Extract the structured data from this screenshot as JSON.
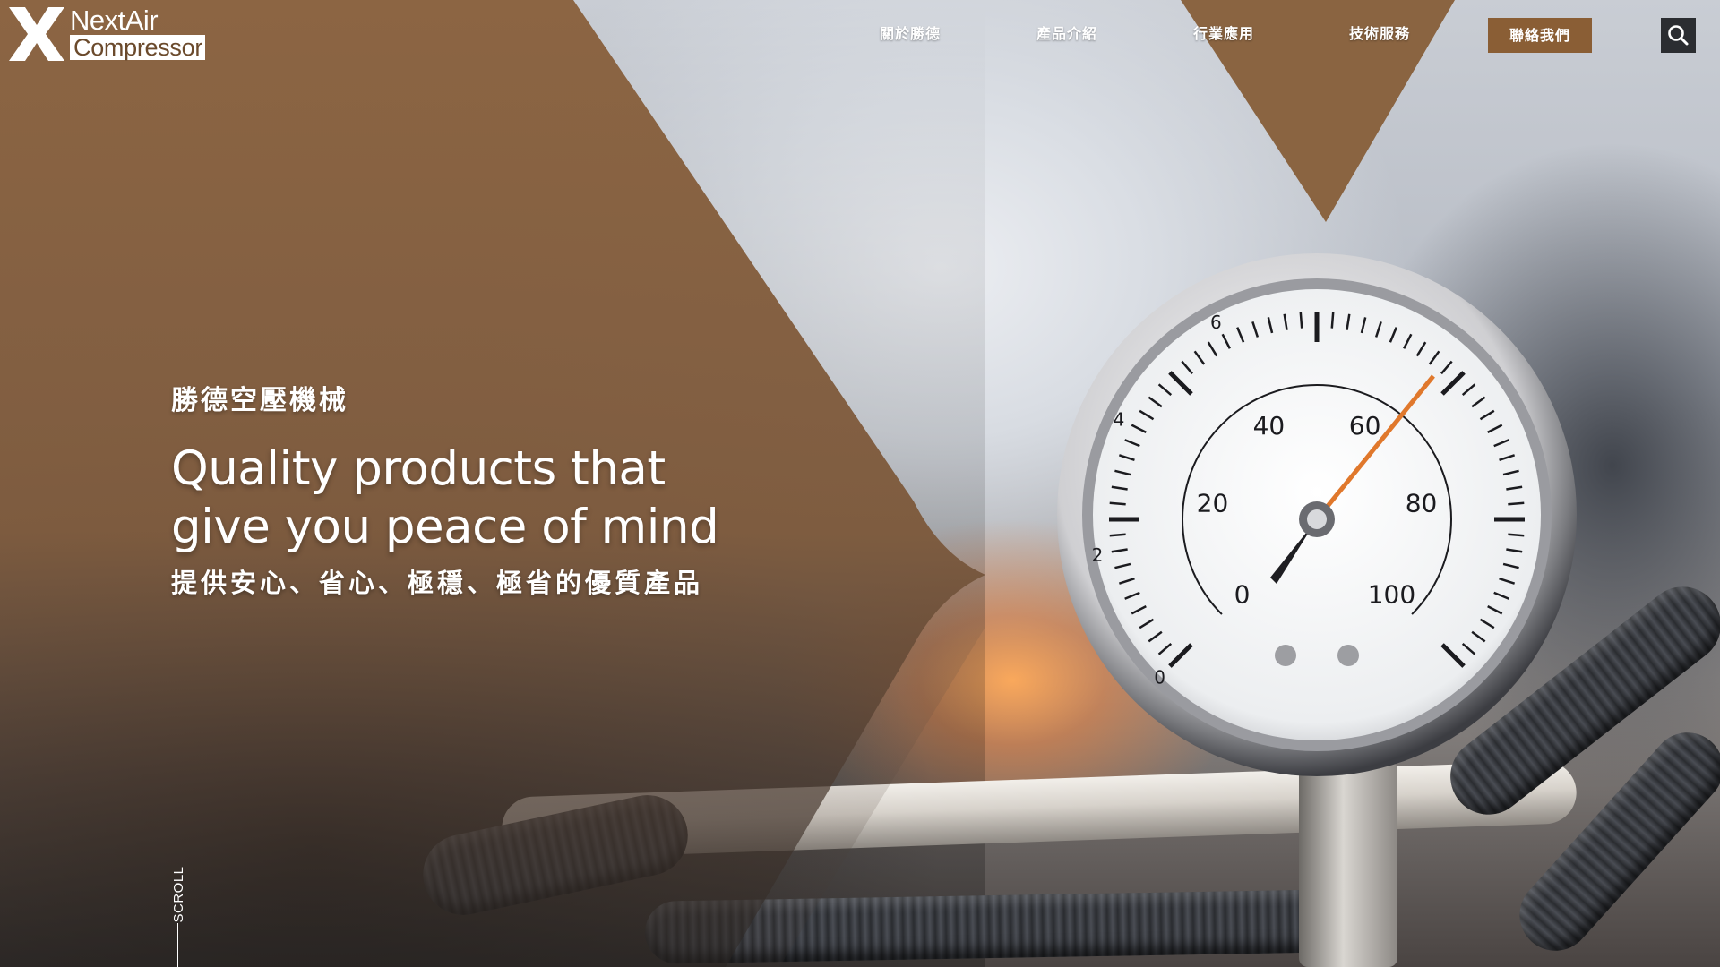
{
  "brand": {
    "name": "NextAir",
    "sub": "Compressor",
    "color_primary": "#8a5e35",
    "color_panel": "#8a6441"
  },
  "nav": {
    "items": [
      {
        "label": "關於勝德"
      },
      {
        "label": "產品介紹"
      },
      {
        "label": "行業應用"
      },
      {
        "label": "技術服務"
      }
    ],
    "contact_label": "聯絡我們",
    "search_icon": "search-icon"
  },
  "hero": {
    "company": "勝德空壓機械",
    "headline_line1": "Quality products that",
    "headline_line2": "give you peace of mind",
    "tagline": "提供安心、省心、極穩、極省的優質產品"
  },
  "gauge": {
    "outer_labels": [
      "0",
      "2",
      "4",
      "6"
    ],
    "inner_labels": [
      "0",
      "20",
      "40",
      "60",
      "80",
      "100"
    ]
  },
  "scroll": {
    "label": "SCROLL"
  }
}
